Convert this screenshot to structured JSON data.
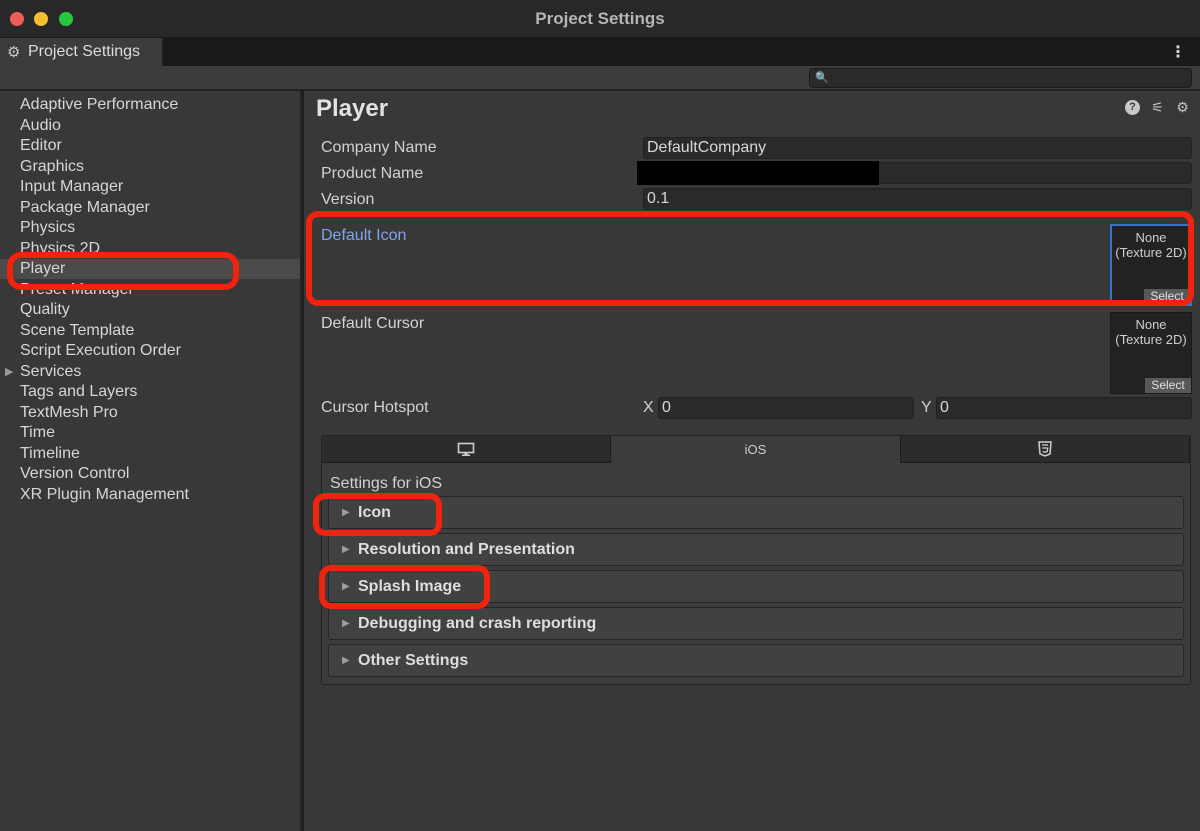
{
  "window": {
    "title": "Project Settings"
  },
  "tab": {
    "label": "Project Settings",
    "icon": "gear-icon"
  },
  "search": {
    "placeholder": "",
    "value": ""
  },
  "sidebar": {
    "items": [
      {
        "label": "Adaptive Performance"
      },
      {
        "label": "Audio"
      },
      {
        "label": "Editor"
      },
      {
        "label": "Graphics"
      },
      {
        "label": "Input Manager"
      },
      {
        "label": "Package Manager"
      },
      {
        "label": "Physics"
      },
      {
        "label": "Physics 2D"
      },
      {
        "label": "Player",
        "selected": true
      },
      {
        "label": "Preset Manager"
      },
      {
        "label": "Quality"
      },
      {
        "label": "Scene Template"
      },
      {
        "label": "Script Execution Order"
      },
      {
        "label": "Services",
        "expandable": true
      },
      {
        "label": "Tags and Layers"
      },
      {
        "label": "TextMesh Pro"
      },
      {
        "label": "Time"
      },
      {
        "label": "Timeline"
      },
      {
        "label": "Version Control"
      },
      {
        "label": "XR Plugin Management"
      }
    ]
  },
  "player": {
    "title": "Player",
    "company_name_label": "Company Name",
    "company_name_value": "DefaultCompany",
    "product_name_label": "Product Name",
    "version_label": "Version",
    "version_value": "0.1",
    "default_icon_label": "Default Icon",
    "default_icon_slot": {
      "line1": "None",
      "line2": "(Texture 2D)",
      "button": "Select"
    },
    "default_cursor_label": "Default Cursor",
    "default_cursor_slot": {
      "line1": "None",
      "line2": "(Texture 2D)",
      "button": "Select"
    },
    "cursor_hotspot_label": "Cursor Hotspot",
    "hotspot_x_label": "X",
    "hotspot_x_value": "0",
    "hotspot_y_label": "Y",
    "hotspot_y_value": "0"
  },
  "platform_tabs": {
    "tabs": [
      {
        "icon": "desktop-icon"
      },
      {
        "label": "iOS",
        "active": true
      },
      {
        "icon": "html5-icon"
      }
    ],
    "settings_for": "Settings for iOS",
    "sections": [
      {
        "label": "Icon"
      },
      {
        "label": "Resolution and Presentation"
      },
      {
        "label": "Splash Image"
      },
      {
        "label": "Debugging and crash reporting"
      },
      {
        "label": "Other Settings"
      }
    ]
  },
  "colors": {
    "annotation": "#f0230e",
    "link_label": "#7fa6e8",
    "focus_border": "#3a72c4"
  }
}
